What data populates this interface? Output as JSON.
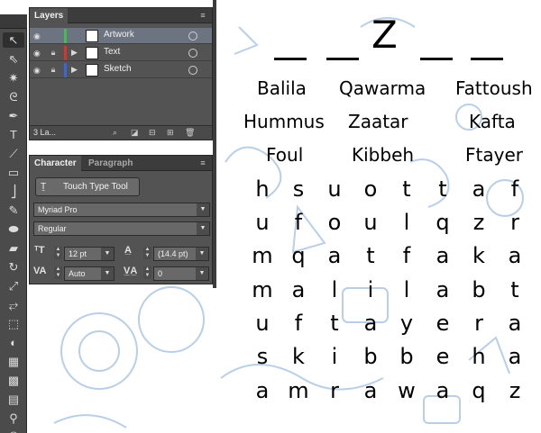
{
  "puzzle": {
    "hidden_letter": "Z",
    "words": [
      "Balila",
      "Qawarma",
      "Fattoush",
      "Hummus",
      "Zaatar",
      "Kafta",
      "Foul",
      "Kibbeh",
      "Ftayer"
    ],
    "grid": [
      [
        "h",
        "s",
        "u",
        "o",
        "t",
        "t",
        "a",
        "f"
      ],
      [
        "u",
        "f",
        "o",
        "u",
        "l",
        "q",
        "z",
        "r"
      ],
      [
        "m",
        "q",
        "a",
        "t",
        "f",
        "a",
        "k",
        "a"
      ],
      [
        "m",
        "a",
        "l",
        "i",
        "l",
        "a",
        "b",
        "t"
      ],
      [
        "u",
        "f",
        "t",
        "a",
        "y",
        "e",
        "r",
        "a"
      ],
      [
        "s",
        "k",
        "i",
        "b",
        "b",
        "e",
        "h",
        "a"
      ],
      [
        "a",
        "m",
        "r",
        "a",
        "w",
        "a",
        "q",
        "z"
      ]
    ]
  },
  "layers_panel": {
    "tab": "Layers",
    "layers": [
      {
        "name": "Artwork",
        "color": "#3fbf4c",
        "selected": true
      },
      {
        "name": "Text",
        "color": "#d9342b",
        "selected": false
      },
      {
        "name": "Sketch",
        "color": "#3a66d8",
        "selected": false
      }
    ],
    "count": "3 La..."
  },
  "character_panel": {
    "tabs": [
      "Character",
      "Paragraph"
    ],
    "touch_type_label": "Touch Type Tool",
    "font_family": "Myriad Pro",
    "font_style": "Regular",
    "font_size": "12 pt",
    "leading": "(14.4 pt)",
    "kerning": "Auto",
    "tracking": "0"
  },
  "icons": {
    "toolbar": [
      "selection-icon",
      "direct-selection-icon",
      "magic-wand-icon",
      "lasso-icon",
      "pen-icon",
      "type-icon",
      "line-icon",
      "rectangle-icon",
      "paintbrush-icon",
      "pencil-icon",
      "blob-brush-icon",
      "eraser-icon",
      "rotate-icon",
      "scale-icon",
      "width-icon",
      "free-transform-icon",
      "shape-builder-icon",
      "perspective-icon",
      "mesh-icon",
      "gradient-icon",
      "eyedropper-icon",
      "blend-icon"
    ],
    "accent_selected_row": "#6c7381"
  }
}
